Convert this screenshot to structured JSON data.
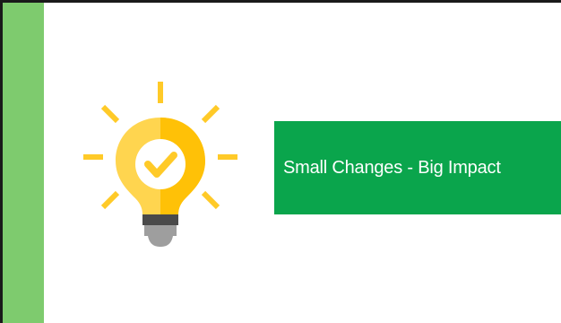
{
  "slide": {
    "headline": "Small Changes - Big Impact"
  },
  "icons": {
    "bulb": "lightbulb-check-icon"
  },
  "colors": {
    "side_bar": "#7ecb6e",
    "banner": "#0aa54c",
    "bulb_light": "#ffd54f",
    "bulb_shade": "#ffc107",
    "rays": "#ffca28",
    "base_dark": "#4a4a4a",
    "base_light": "#9e9e9e"
  }
}
